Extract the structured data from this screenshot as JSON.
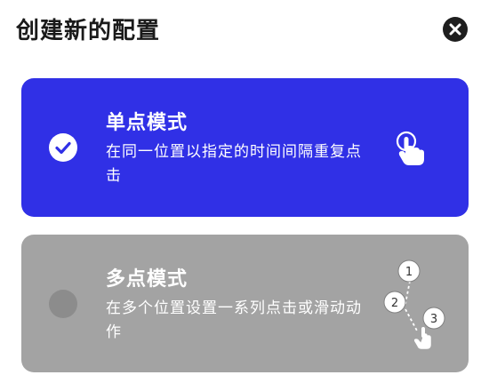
{
  "dialog": {
    "title": "创建新的配置"
  },
  "options": [
    {
      "id": "single",
      "title": "单点模式",
      "description": "在同一位置以指定的时间间隔重复点击",
      "selected": true,
      "icon": "single-tap-icon"
    },
    {
      "id": "multi",
      "title": "多点模式",
      "description": "在多个位置设置一系列点击或滑动动作",
      "selected": false,
      "icon": "multi-tap-icon",
      "steps": [
        "1",
        "2",
        "3"
      ]
    }
  ],
  "colors": {
    "selected_card": "#3030e6",
    "unselected_card": "#a3a3a3",
    "title_text": "#1a1a1a"
  }
}
